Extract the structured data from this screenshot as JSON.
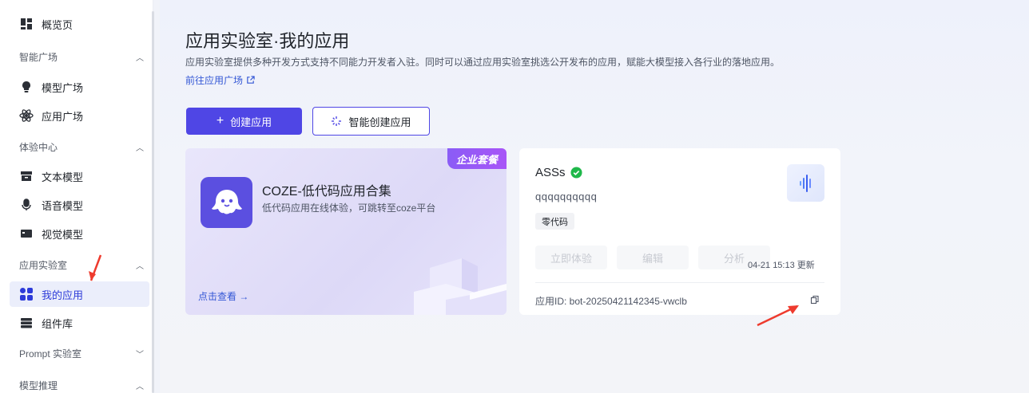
{
  "sidebar": {
    "overview": "概览页",
    "groups": [
      {
        "label": "智能广场",
        "items": [
          "模型广场",
          "应用广场"
        ]
      },
      {
        "label": "体验中心",
        "items": [
          "文本模型",
          "语音模型",
          "视觉模型"
        ]
      },
      {
        "label": "应用实验室",
        "items": [
          "我的应用",
          "组件库"
        ]
      },
      {
        "label": "Prompt 实验室",
        "items": []
      },
      {
        "label": "模型推理",
        "items": []
      }
    ],
    "active_item": "我的应用"
  },
  "main": {
    "title": "应用实验室·我的应用",
    "description": "应用实验室提供多种开发方式支持不同能力开发者入驻。同时可以通过应用实验室挑选公开发布的应用，赋能大模型接入各行业的落地应用。",
    "link_label": "前往应用广场",
    "create_button": "创建应用",
    "smart_create_button": "智能创建应用"
  },
  "coze_card": {
    "badge": "企业套餐",
    "title": "COZE-低代码应用合集",
    "subtitle": "低代码应用在线体验，可跳转至coze平台",
    "more": "点击查看 →"
  },
  "app_card": {
    "name": "ASSs",
    "description": "qqqqqqqqqq",
    "tag": "零代码",
    "actions": [
      "立即体验",
      "编辑",
      "分析"
    ],
    "updated": "04-21 15:13 更新",
    "app_id": "应用ID: bot-20250421142345-vwclb"
  },
  "colors": {
    "primary": "#4f46e5",
    "link": "#3457d5",
    "success": "#1fb84a",
    "annotation_arrow": "#ee3b2e"
  }
}
